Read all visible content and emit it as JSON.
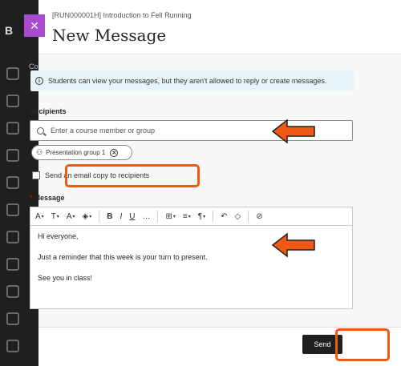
{
  "course_code": "[RUN000001H] Introduction to Fell Running",
  "panel_title": "New Message",
  "rail_partial_text": "Co",
  "info_banner": "Students can view your messages, but they aren't allowed to reply or create messages.",
  "recipients": {
    "label": "Recipients",
    "placeholder": "Enter a course member or group",
    "chips": [
      {
        "label": "Presentation group 1"
      }
    ]
  },
  "email_copy_label": "Send an email copy to recipients",
  "message": {
    "label": "Message",
    "required_marker": "*",
    "lines": [
      "Hi everyone,",
      "Just a reminder that this week is your turn to present.",
      "See you in class!"
    ]
  },
  "toolbar": {
    "items": [
      "paragraph-style",
      "text-style",
      "font-size",
      "highlight",
      "bold",
      "italic",
      "underline",
      "more",
      "table",
      "align",
      "paragraph",
      "undo",
      "clear-format",
      "link"
    ],
    "bold": "B",
    "italic": "I",
    "underline": "U",
    "more": "…"
  },
  "send_label": "Send",
  "colors": {
    "accent_purple": "#a84bcf",
    "highlight_orange": "#ee5a15",
    "info_bg": "#e7f4f8",
    "send_bg": "#1f1f1f"
  }
}
